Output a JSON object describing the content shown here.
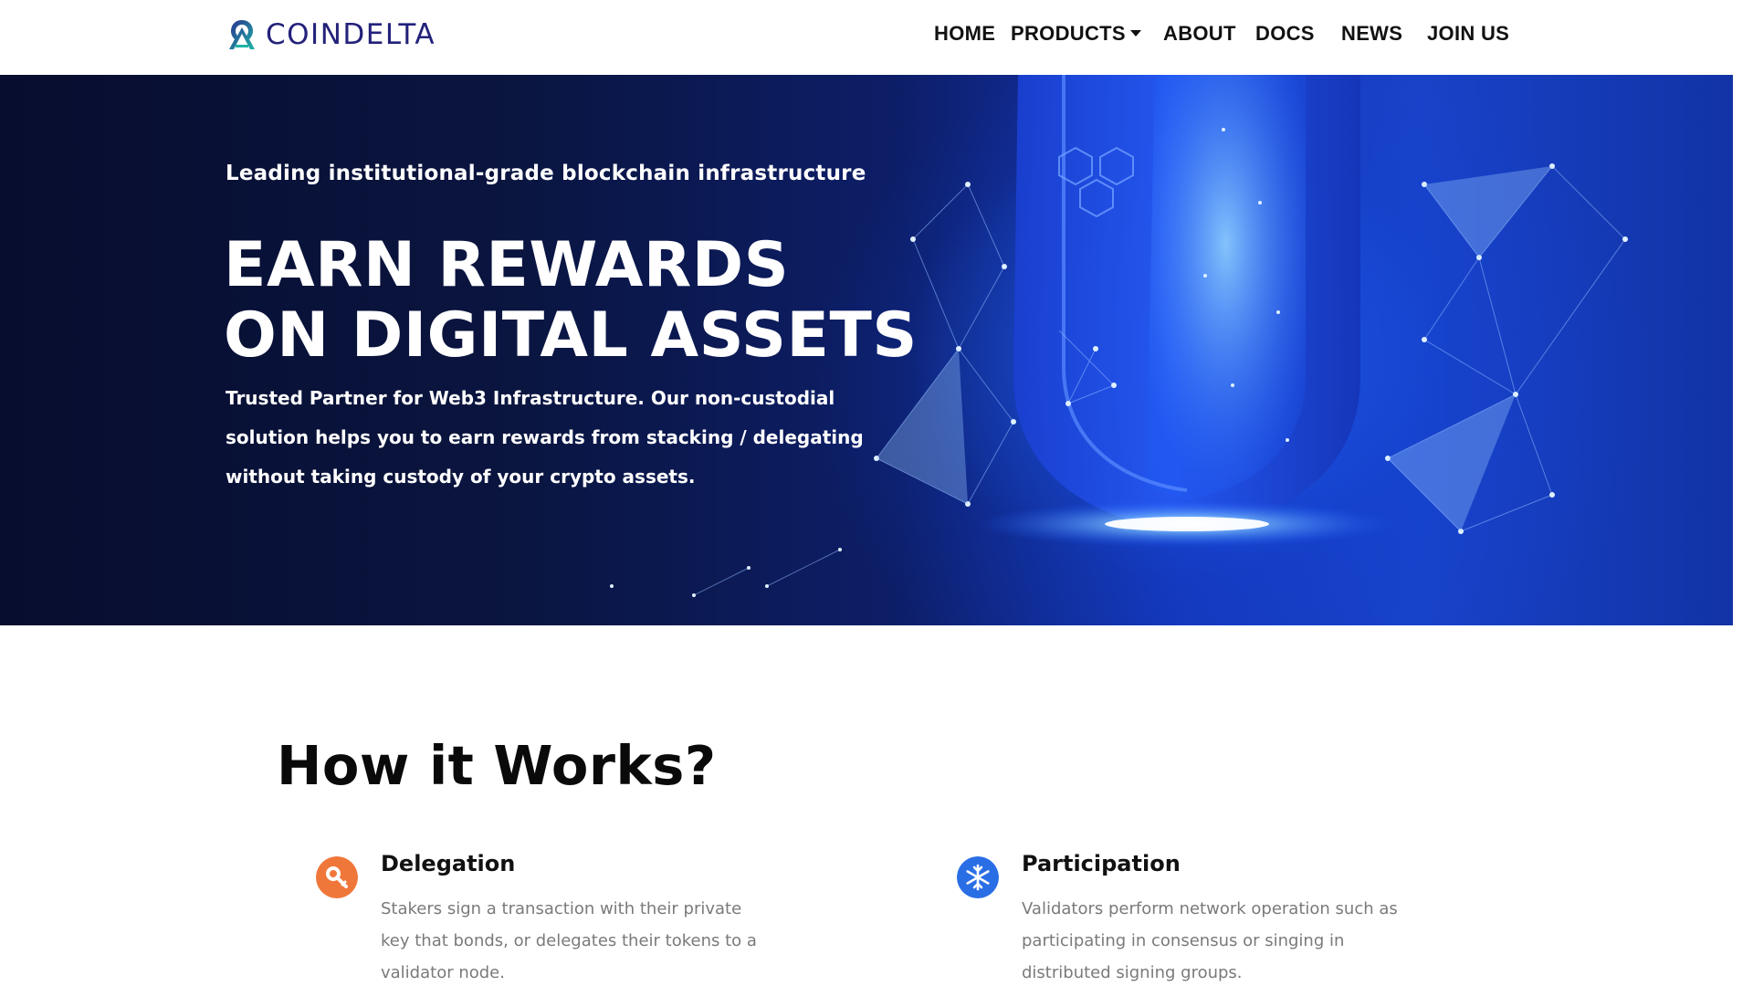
{
  "brand": {
    "name": "COINDELTA",
    "primary_color": "#23217a",
    "accent_color": "#1fb5a6"
  },
  "nav": {
    "items": [
      {
        "label": "HOME"
      },
      {
        "label": "PRODUCTS",
        "has_dropdown": true
      },
      {
        "label": "ABOUT"
      },
      {
        "label": "DOCS"
      },
      {
        "label": "NEWS"
      },
      {
        "label": "JOIN US"
      }
    ]
  },
  "hero": {
    "kicker": "Leading institutional-grade blockchain infrastructure",
    "title_line1": "EARN REWARDS",
    "title_line2": "ON DIGITAL ASSETS",
    "description": "Trusted Partner for Web3 Infrastructure. Our non-custodial solution helps you to earn rewards from stacking / delegating without taking custody of your crypto assets.",
    "background_color": "#0b1a5c",
    "art": "blue-shield-network-icon"
  },
  "how_it_works": {
    "title": "How  it Works?",
    "steps": [
      {
        "title": "Delegation",
        "text": "Stakers sign a transaction with their private key that bonds, or delegates their tokens to a validator node.",
        "icon": "key-icon",
        "icon_color": "#f0773a"
      },
      {
        "title": "Participation",
        "text": "Validators perform network operation such as participating in consensus or singing in distributed signing groups.",
        "icon": "snowflake-icon",
        "icon_color": "#2a6ee6"
      }
    ]
  }
}
